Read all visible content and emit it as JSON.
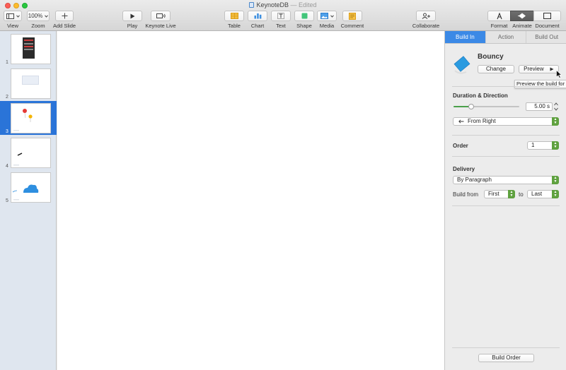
{
  "window": {
    "title": "KeynoteDB",
    "edited": "— Edited"
  },
  "toolbar": {
    "view_label": "View",
    "zoom_value": "100%",
    "zoom_label": "Zoom",
    "add_slide_label": "Add Slide",
    "play_label": "Play",
    "keynote_live_label": "Keynote Live",
    "table_label": "Table",
    "chart_label": "Chart",
    "text_label": "Text",
    "shape_label": "Shape",
    "media_label": "Media",
    "comment_label": "Comment",
    "collaborate_label": "Collaborate",
    "format_label": "Format",
    "animate_label": "Animate",
    "document_label": "Document"
  },
  "navigator": {
    "slides": [
      {
        "number": "1"
      },
      {
        "number": "2"
      },
      {
        "number": "3"
      },
      {
        "number": "4"
      },
      {
        "number": "5"
      }
    ]
  },
  "inspector": {
    "tabs": [
      "Build In",
      "Action",
      "Build Out"
    ],
    "effect_name": "Bouncy",
    "change_label": "Change",
    "preview_label": "Preview",
    "tooltip": "Preview the build for t",
    "duration_title": "Duration & Direction",
    "duration_value": "5.00 s",
    "duration_fraction": 0.27,
    "direction_value": "From Right",
    "order_title": "Order",
    "order_value": "1",
    "delivery_title": "Delivery",
    "delivery_value": "By Paragraph",
    "build_from_label": "Build from",
    "build_from_value": "First",
    "to_label": "to",
    "to_value": "Last",
    "build_order_label": "Build Order"
  },
  "colors": {
    "selection": "#2a74d8",
    "tab_active": "#3b89e6",
    "popup_green": "#5fa13f",
    "effect_icon": "#2b9be0"
  }
}
